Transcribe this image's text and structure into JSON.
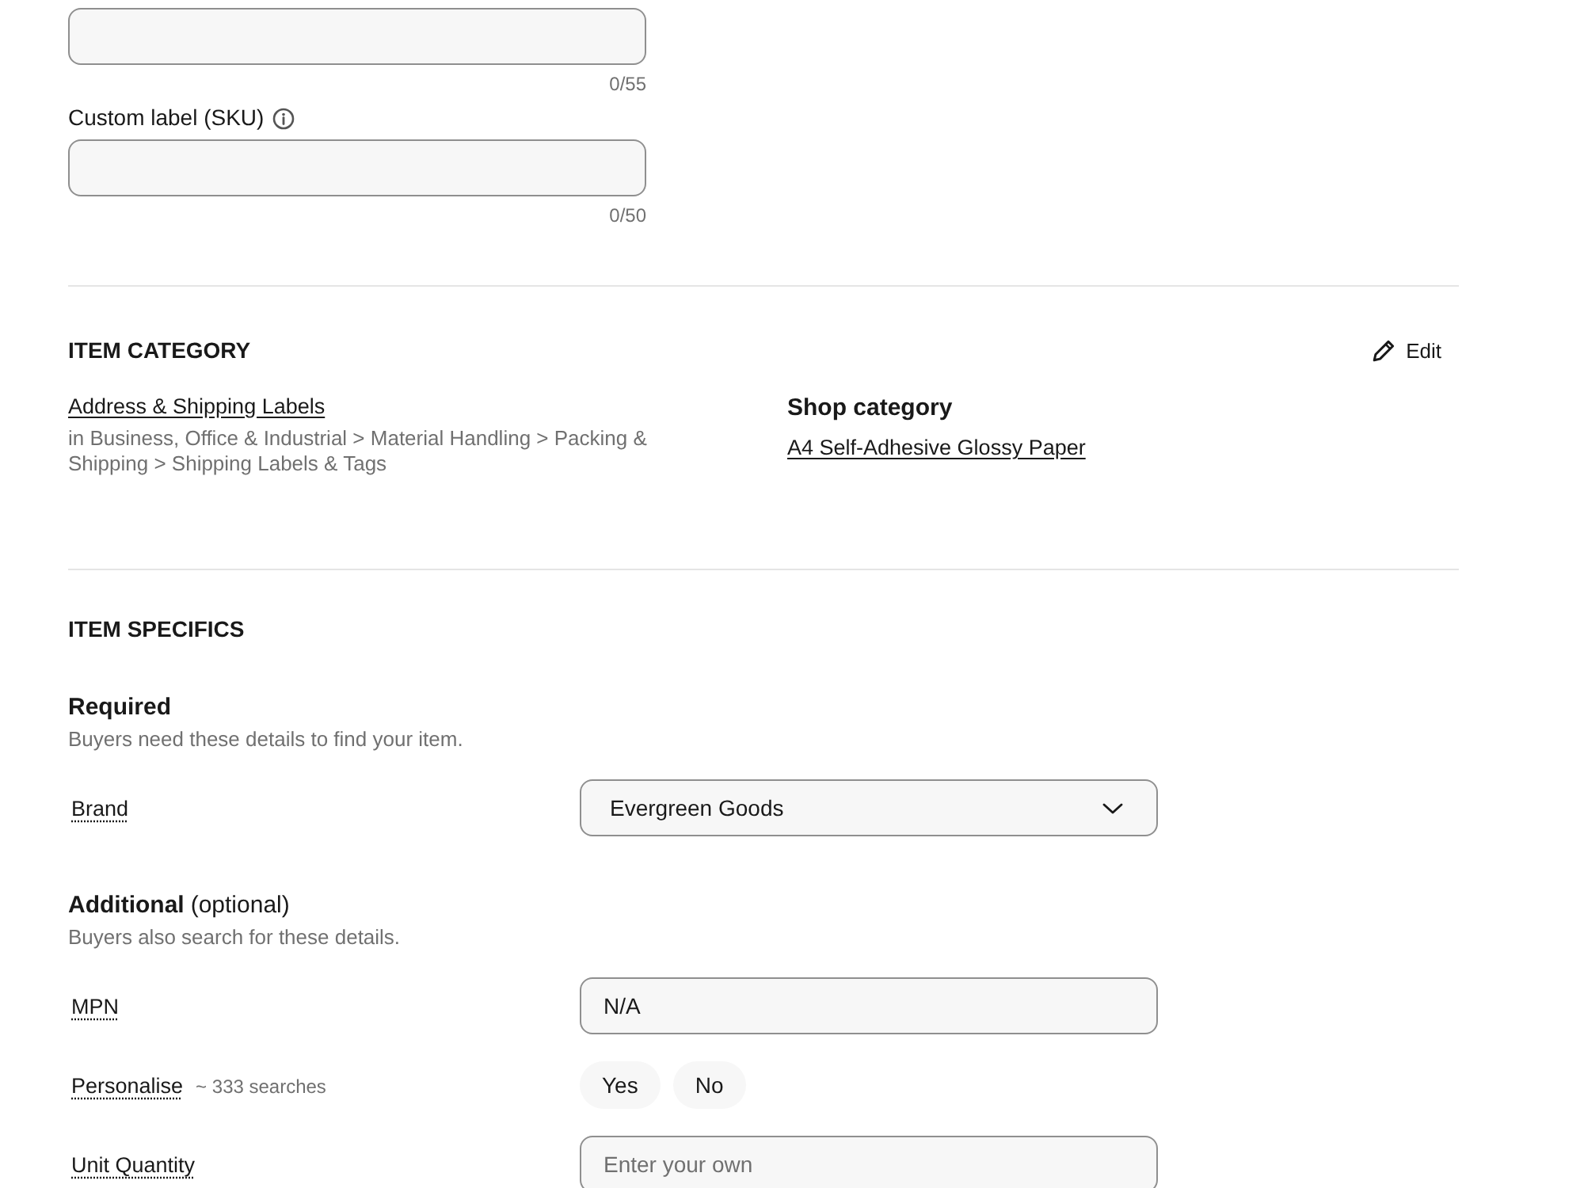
{
  "text_fields": [
    {
      "counter": "0/55"
    },
    {
      "label": "Custom label (SKU)",
      "info_icon": true,
      "counter": "0/50"
    }
  ],
  "item_category": {
    "heading": "ITEM CATEGORY",
    "edit_label": "Edit",
    "category": {
      "name": "Address & Shipping Labels",
      "path": "in Business, Office & Industrial > Material Handling > Packing & Shipping > Shipping Labels & Tags"
    },
    "shop_category": {
      "heading": "Shop category",
      "name": "A4 Self-Adhesive Glossy Paper"
    }
  },
  "item_specifics": {
    "heading": "ITEM SPECIFICS",
    "groups": [
      {
        "title": "Required",
        "description": "Buyers need these details to find your item.",
        "fields": [
          {
            "kind": "select",
            "label": "Brand",
            "value": "Evergreen Goods"
          }
        ]
      },
      {
        "title": "Additional",
        "note": "(optional)",
        "description": "Buyers also search for these details.",
        "fields": [
          {
            "kind": "text",
            "label": "MPN",
            "value": "N/A"
          },
          {
            "kind": "choice",
            "label": "Personalise",
            "hint": "~ 333 searches",
            "options": [
              {
                "label": "Yes",
                "selected": false
              },
              {
                "label": "No",
                "selected": false
              }
            ]
          },
          {
            "kind": "text",
            "label": "Unit Quantity",
            "placeholder": "Enter your own"
          }
        ]
      }
    ]
  }
}
